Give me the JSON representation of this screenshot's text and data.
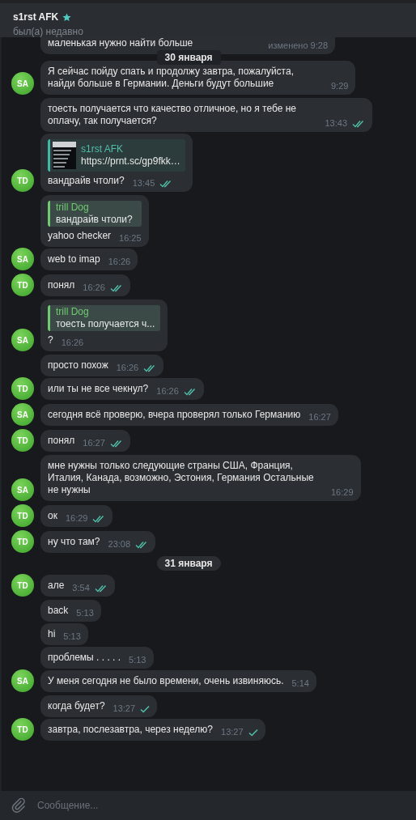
{
  "header": {
    "title": "s1rst AFK",
    "starred": true,
    "status": "был(а) недавно"
  },
  "chat": [
    {
      "kind": "group",
      "messages": [
        {
          "text": "маленькая  нужно найти больше",
          "time": "изменено 9:28",
          "partial": true
        }
      ]
    },
    {
      "kind": "date",
      "text": "30 января",
      "floating": true
    },
    {
      "kind": "group",
      "avatar": "SA",
      "messages": [
        {
          "text": "Я сейчас пойду спать и продолжу завтра, пожалуйста, найди больше в Германии. Деньги будут большие",
          "time": "9:29"
        }
      ]
    },
    {
      "kind": "group",
      "avatar": "TD",
      "messages": [
        {
          "text": "тоесть получается что качество отличное, но я тебе не оплачу, так получается?",
          "time": "13:43",
          "read": true
        },
        {
          "link": {
            "title": "s1rst AFK",
            "url": "https://prnt.sc/gp9fkk…",
            "kind": "picture"
          },
          "text": "вандрайв чтоли?",
          "time": "13:45",
          "read": true
        }
      ]
    },
    {
      "kind": "group",
      "avatar": "SA",
      "messages": [
        {
          "reply": {
            "author": "trill Dog",
            "text": "вандрайв чтоли?"
          },
          "text": "yahoo checker",
          "time": "16:25"
        },
        {
          "text": "web to imap",
          "time": "16:26"
        }
      ]
    },
    {
      "kind": "group",
      "avatar": "TD",
      "messages": [
        {
          "text": "понял",
          "time": "16:26",
          "read": true
        }
      ]
    },
    {
      "kind": "group",
      "avatar": "SA",
      "messages": [
        {
          "reply": {
            "author": "trill Dog",
            "text": "тоесть получается ч..."
          },
          "text": "?",
          "time": "16:26"
        }
      ]
    },
    {
      "kind": "group",
      "avatar": "TD",
      "messages": [
        {
          "text": "просто похож",
          "time": "16:26",
          "read": true
        },
        {
          "text": "или ты не все чекнул?",
          "time": "16:26",
          "read": true
        }
      ]
    },
    {
      "kind": "group",
      "avatar": "SA",
      "messages": [
        {
          "text": "сегодня всё проверю, вчера проверял только Германию",
          "time": "16:27"
        }
      ]
    },
    {
      "kind": "group",
      "avatar": "TD",
      "messages": [
        {
          "text": "понял",
          "time": "16:27",
          "read": true
        }
      ]
    },
    {
      "kind": "group",
      "avatar": "SA",
      "messages": [
        {
          "text": "мне нужны только следующие страны США, Франция, Италия, Канада, возможно, Эстония, Германия Остальные не нужны",
          "time": "16:29"
        }
      ]
    },
    {
      "kind": "group",
      "avatar": "TD",
      "messages": [
        {
          "text": "ок",
          "time": "16:29",
          "read": true
        }
      ]
    },
    {
      "kind": "group",
      "avatar": "TD",
      "messages": [
        {
          "text": "ну что там?",
          "time": "23:08",
          "read": true
        }
      ]
    },
    {
      "kind": "date",
      "text": "31 января",
      "floating": false
    },
    {
      "kind": "group",
      "avatar": "TD",
      "messages": [
        {
          "text": "але",
          "time": "3:54",
          "read": true
        }
      ]
    },
    {
      "kind": "group",
      "avatar": "SA",
      "messages": [
        {
          "text": "back",
          "time": "5:13"
        },
        {
          "text": "hi",
          "time": "5:13"
        },
        {
          "text": "проблемы . . . . .",
          "time": "5:13"
        },
        {
          "text": "У меня сегодня не было времени, очень извиняюсь.",
          "time": "5:14"
        }
      ]
    },
    {
      "kind": "group",
      "avatar": "TD",
      "messages": [
        {
          "text": "когда будет?",
          "time": "13:27",
          "read": false
        },
        {
          "text": "завтра, послезавтра, через неделю?",
          "time": "13:27",
          "read": false
        }
      ]
    }
  ],
  "composer": {
    "placeholder": "Сообщение..."
  }
}
